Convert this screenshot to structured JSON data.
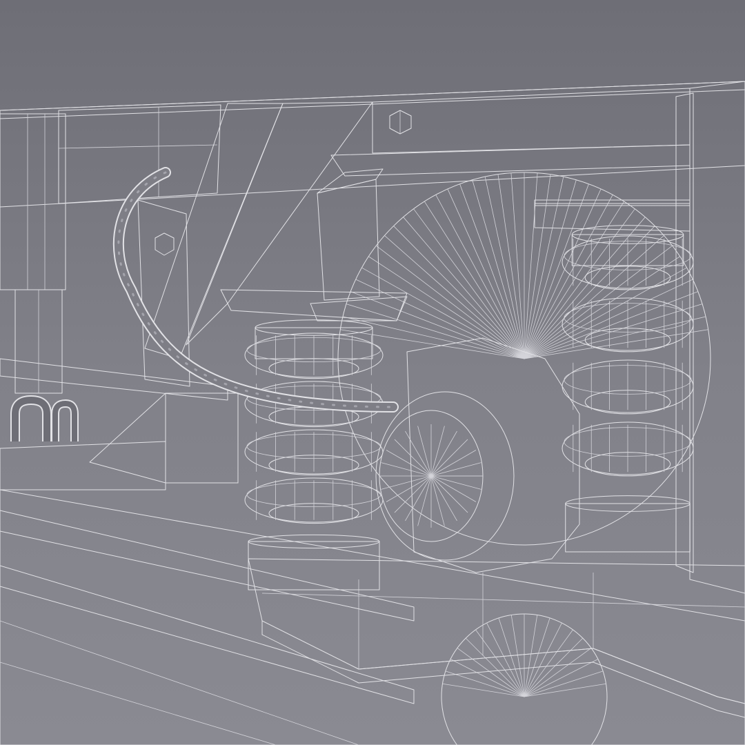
{
  "scene": {
    "render_mode": "wireframe-shaded",
    "colors": {
      "background_top": "#707078",
      "background_bottom": "#8a8a92",
      "mesh_light": "#8c8c94",
      "mesh_mid": "#6a6a72",
      "mesh_dark": "#4c4c54",
      "mesh_shadow": "#34343a",
      "wireframe": "#e2e2e6"
    },
    "parts": [
      "body-frame",
      "hydraulic-damper",
      "brake-hose",
      "coil-spring-left",
      "coil-spring-right",
      "axle-box-cap",
      "bogie-side-frame",
      "rail",
      "wheel"
    ]
  }
}
